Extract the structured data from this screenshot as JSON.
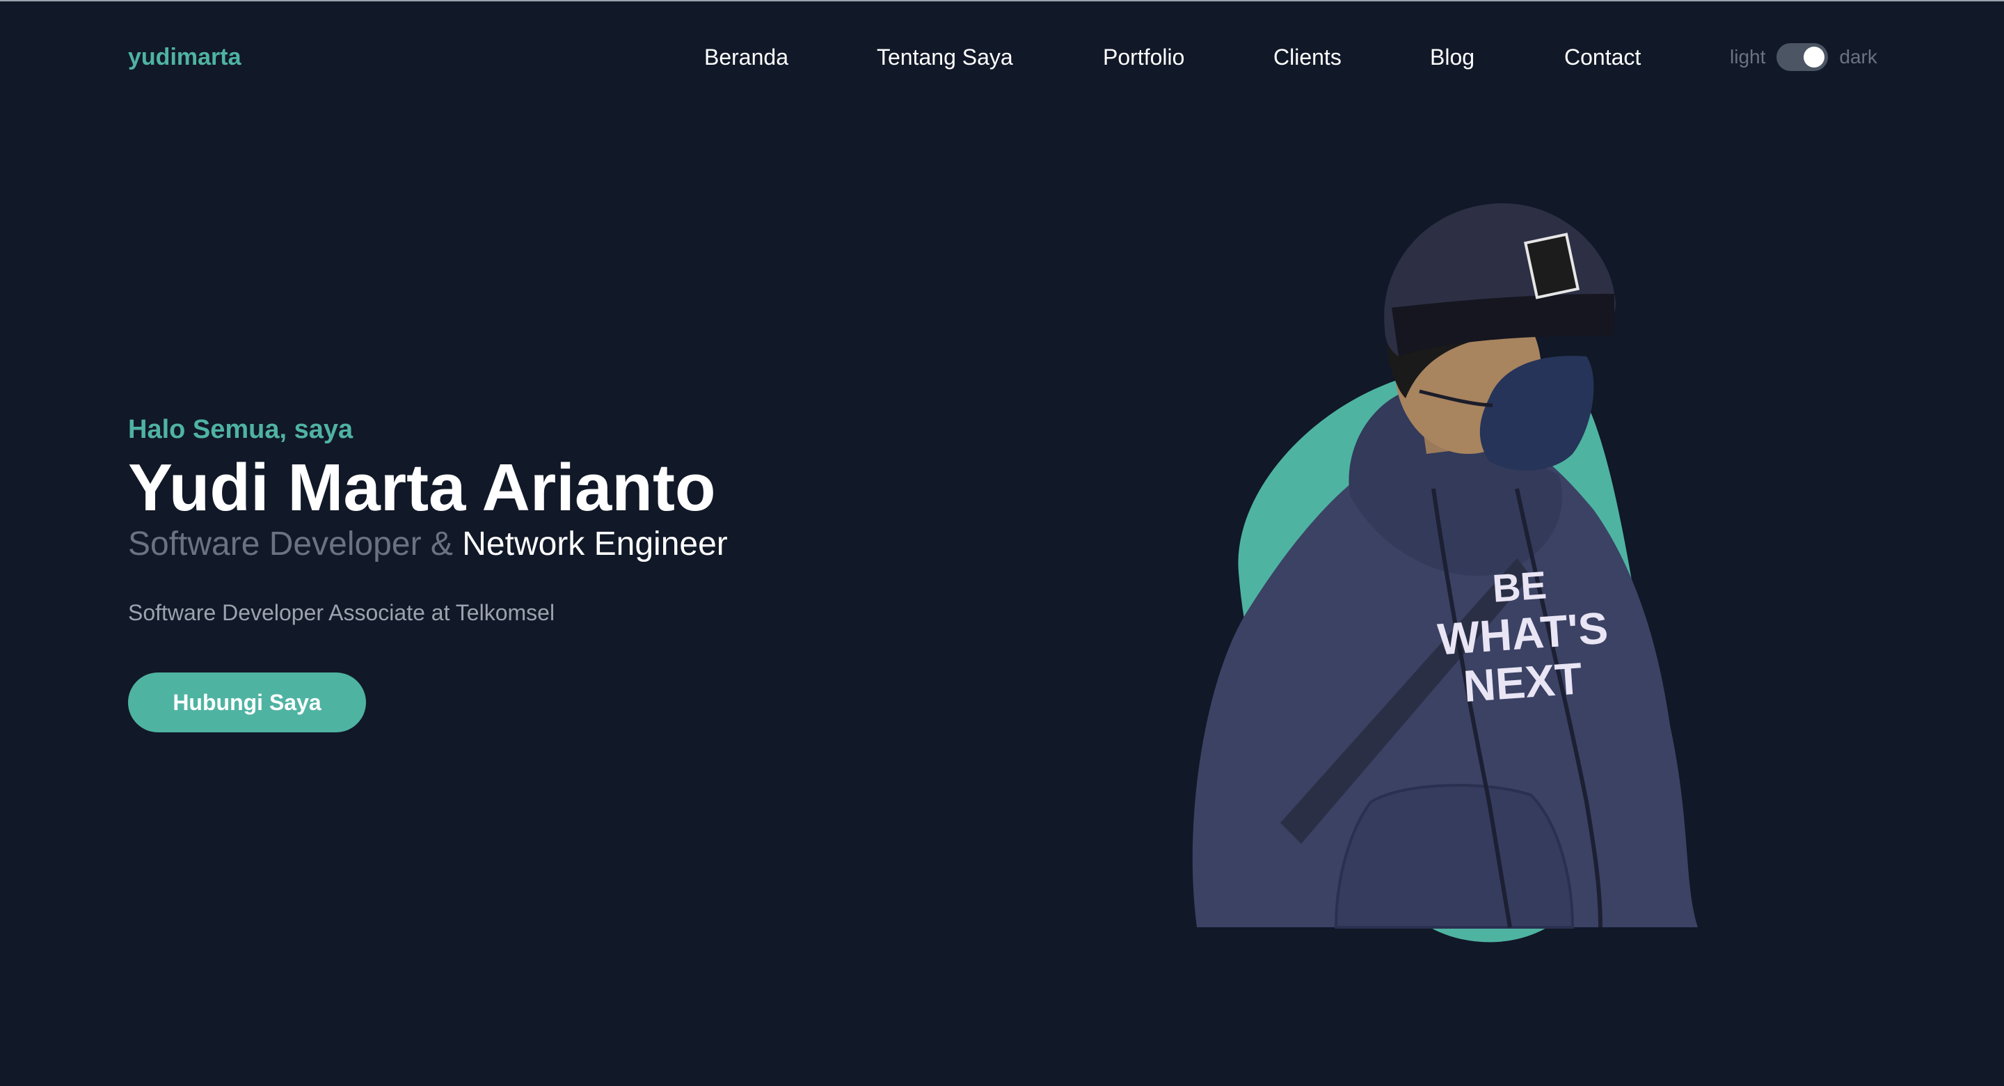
{
  "brand": {
    "logo": "yudimarta"
  },
  "nav": {
    "items": [
      {
        "label": "Beranda"
      },
      {
        "label": "Tentang Saya"
      },
      {
        "label": "Portfolio"
      },
      {
        "label": "Clients"
      },
      {
        "label": "Blog"
      },
      {
        "label": "Contact"
      }
    ]
  },
  "theme": {
    "light_label": "light",
    "dark_label": "dark",
    "mode": "dark"
  },
  "hero": {
    "greeting": "Halo Semua, saya",
    "name": "Yudi Marta Arianto",
    "role_part1": "Software Developer &",
    "role_part2": "Network Engineer",
    "description": "Software Developer Associate at Telkomsel",
    "cta_label": "Hubungi Saya"
  },
  "colors": {
    "background": "#111827",
    "accent": "#4fb3a2",
    "muted": "#6b7280",
    "hoodie": "#3b4264"
  },
  "portrait": {
    "hoodie_print": [
      "BE",
      "WHAT'S",
      "NEXT"
    ]
  }
}
